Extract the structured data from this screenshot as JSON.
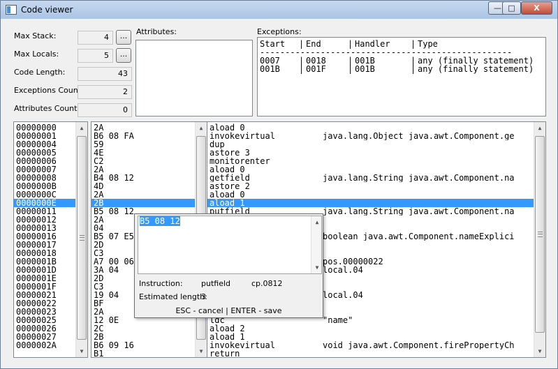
{
  "window": {
    "title": "Code viewer",
    "minimize_glyph": "—",
    "maximize_glyph": "□",
    "close_glyph": "X"
  },
  "colors": {
    "selection": "#3399ff",
    "titlebar": "#aac4e4",
    "close": "#c24a35"
  },
  "props": {
    "max_stack_label": "Max Stack:",
    "max_stack_value": "4",
    "max_locals_label": "Max Locals:",
    "max_locals_value": "5",
    "code_length_label": "Code Length:",
    "code_length_value": "43",
    "exceptions_count_label": "Exceptions Count:",
    "exceptions_count_value": "2",
    "attributes_count_label": "Attributes Count:",
    "attributes_count_value": "0",
    "edit_button_label": "..."
  },
  "attributes": {
    "label": "Attributes:"
  },
  "exceptions": {
    "label": "Exceptions:",
    "headers": [
      "Start",
      "End",
      "Handler",
      "Type"
    ],
    "separator": "|",
    "rule": "--------------------------------------------------",
    "rows": [
      [
        "0007",
        "0018",
        "001B",
        "any (finally statement)"
      ],
      [
        "001B",
        "001F",
        "001B",
        "any (finally statement)"
      ]
    ]
  },
  "code": {
    "selected_index": 9,
    "offsets": [
      "00000000",
      "00000001",
      "00000004",
      "00000005",
      "00000006",
      "00000007",
      "00000008",
      "0000000B",
      "0000000C",
      "0000000E",
      "00000011",
      "00000012",
      "00000013",
      "00000016",
      "00000017",
      "00000018",
      "0000001B",
      "0000001D",
      "0000001E",
      "0000001F",
      "00000021",
      "00000022",
      "00000023",
      "00000025",
      "00000026",
      "00000027",
      "0000002A"
    ],
    "bytes": [
      "2A",
      "B6 08 FA",
      "59",
      "4E",
      "C2",
      "2A",
      "B4 08 12",
      "4D",
      "2A",
      "2B",
      "B5 08 12",
      "2A",
      "04",
      "B5 07 E5",
      "2D",
      "C3",
      "A7 00 06",
      "3A 04",
      "2D",
      "C3",
      "19 04",
      "BF",
      "2A",
      "12 0E",
      "2C",
      "2B",
      "B6 09 16",
      "B1"
    ],
    "instructions": [
      {
        "op": "aload_0",
        "arg": ""
      },
      {
        "op": "invokevirtual",
        "arg": "java.lang.Object java.awt.Component.ge"
      },
      {
        "op": "dup",
        "arg": ""
      },
      {
        "op": "astore_3",
        "arg": ""
      },
      {
        "op": "monitorenter",
        "arg": ""
      },
      {
        "op": "aload_0",
        "arg": ""
      },
      {
        "op": "getfield",
        "arg": "java.lang.String java.awt.Component.na"
      },
      {
        "op": "astore_2",
        "arg": ""
      },
      {
        "op": "aload_0",
        "arg": ""
      },
      {
        "op": "aload_1",
        "arg": ""
      },
      {
        "op": "putfield",
        "arg": "java.lang.String java.awt.Component.na"
      },
      {
        "op": "",
        "arg": ""
      },
      {
        "op": "",
        "arg": ""
      },
      {
        "op": "",
        "arg": "boolean java.awt.Component.nameExplici"
      },
      {
        "op": "",
        "arg": ""
      },
      {
        "op": "",
        "arg": ""
      },
      {
        "op": "",
        "arg": "pos.00000022"
      },
      {
        "op": "",
        "arg": "local.04"
      },
      {
        "op": "",
        "arg": ""
      },
      {
        "op": "",
        "arg": ""
      },
      {
        "op": "",
        "arg": "local.04"
      },
      {
        "op": "",
        "arg": ""
      },
      {
        "op": "",
        "arg": ""
      },
      {
        "op": "ldc",
        "arg": "\"name\""
      },
      {
        "op": "aload_2",
        "arg": ""
      },
      {
        "op": "aload_1",
        "arg": ""
      },
      {
        "op": "invokevirtual",
        "arg": "void java.awt.Component.firePropertyCh"
      },
      {
        "op": "return",
        "arg": ""
      }
    ]
  },
  "editor_popup": {
    "value": "B5 08 12",
    "instruction_label": "Instruction:",
    "instruction_name": "putfield",
    "instruction_operand": "cp.0812",
    "estimated_length_label": "Estimated length:",
    "estimated_length_value": "3",
    "hint": "ESC - cancel | ENTER - save"
  }
}
